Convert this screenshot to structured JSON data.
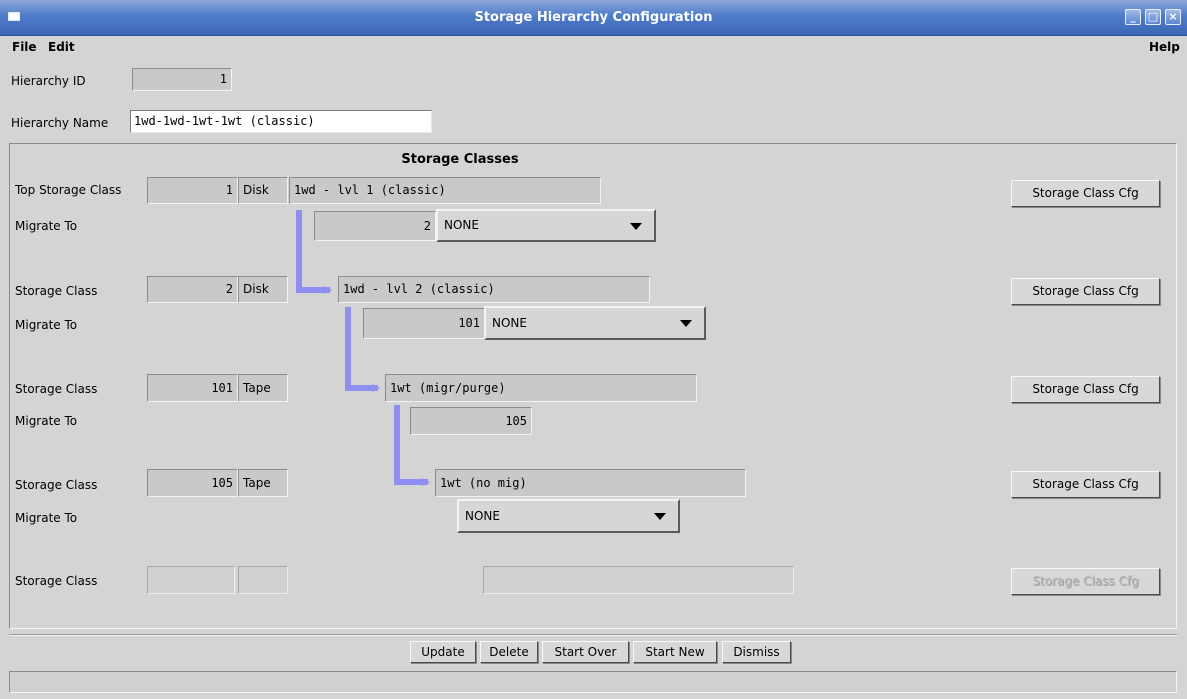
{
  "window": {
    "title": "Storage Hierarchy Configuration"
  },
  "menu": {
    "file": "File",
    "edit": "Edit",
    "help": "Help"
  },
  "hierarchy": {
    "id_label": "Hierarchy ID",
    "id_value": "1",
    "name_label": "Hierarchy Name",
    "name_value": "1wd-1wd-1wt-1wt (classic)"
  },
  "panel": {
    "title": "Storage Classes"
  },
  "rows": [
    {
      "label": "Top Storage Class",
      "id": "1",
      "type": "Disk",
      "name": "1wd - lvl 1 (classic)",
      "cfg_button": "Storage Class Cfg",
      "migrate_label": "Migrate To",
      "migrate_id": "2",
      "migrate_select": "NONE"
    },
    {
      "label": "Storage Class",
      "id": "2",
      "type": "Disk",
      "name": "1wd - lvl 2 (classic)",
      "cfg_button": "Storage Class Cfg",
      "migrate_label": "Migrate To",
      "migrate_id": "101",
      "migrate_select": "NONE"
    },
    {
      "label": "Storage Class",
      "id": "101",
      "type": "Tape",
      "name": "1wt (migr/purge)",
      "cfg_button": "Storage Class Cfg",
      "migrate_label": "Migrate To",
      "migrate_id": "105"
    },
    {
      "label": "Storage Class",
      "id": "105",
      "type": "Tape",
      "name": "1wt (no mig)",
      "cfg_button": "Storage Class Cfg",
      "migrate_label": "Migrate To",
      "migrate_select": "NONE"
    },
    {
      "label": "Storage Class",
      "cfg_button": "Storage Class Cfg"
    }
  ],
  "actions": {
    "update": "Update",
    "delete": "Delete",
    "start_over": "Start Over",
    "start_new": "Start New",
    "dismiss": "Dismiss"
  },
  "colors": {
    "titlebar": "#4f7cc9",
    "arrow": "#8f8ff2",
    "background": "#d4d4d4"
  }
}
